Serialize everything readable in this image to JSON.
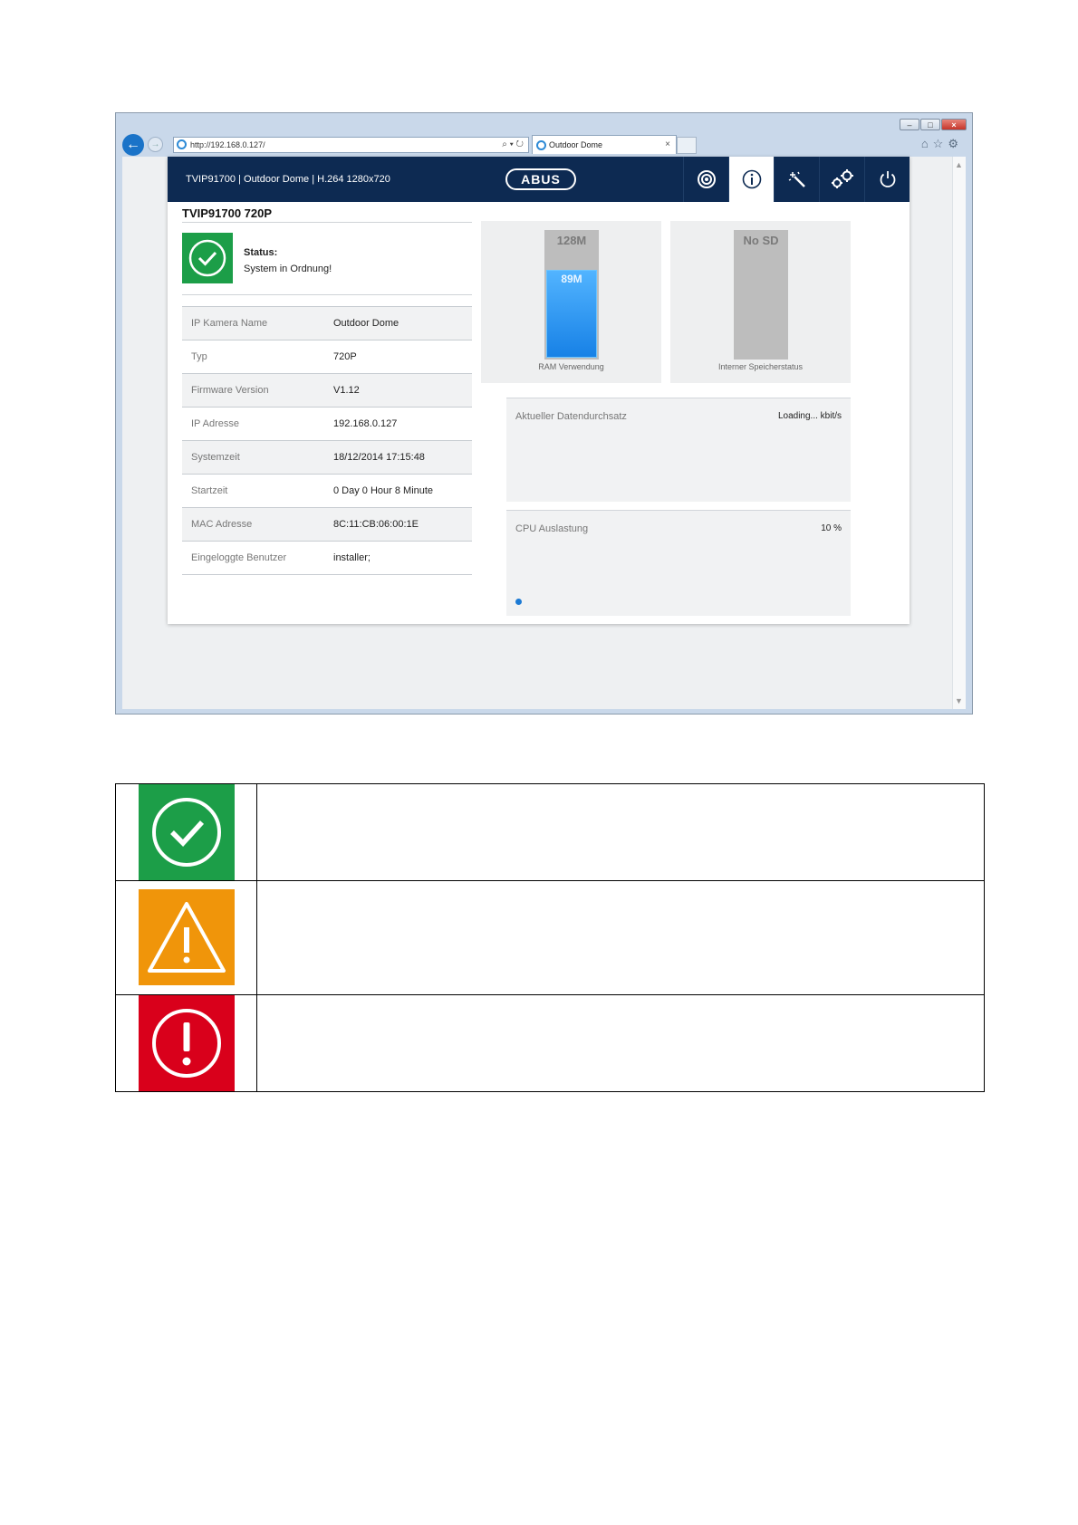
{
  "browser": {
    "url": "http://192.168.0.127/",
    "tab_title": "Outdoor Dome",
    "tab_close": "×",
    "min_label": "–",
    "max_label": "□",
    "close_label": "×",
    "back_glyph": "←",
    "fwd_glyph": "→",
    "addr_tools": "⌕ ▾ ↻",
    "right_icons": "⌂☆⚙",
    "scroll_up": "▲",
    "scroll_down": "▼"
  },
  "header": {
    "title": "TVIP91700 | Outdoor Dome | H.264 1280x720",
    "logo": "ABUS",
    "nav": [
      "live-view",
      "info",
      "wizard",
      "settings",
      "power"
    ]
  },
  "page": {
    "title": "TVIP91700 720P",
    "status_label": "Status:",
    "status_text": "System in Ordnung!"
  },
  "info_rows": [
    {
      "label": "IP Kamera Name",
      "value": "Outdoor Dome"
    },
    {
      "label": "Typ",
      "value": "720P"
    },
    {
      "label": "Firmware Version",
      "value": "V1.12"
    },
    {
      "label": "IP Adresse",
      "value": "192.168.0.127"
    },
    {
      "label": "Systemzeit",
      "value": "18/12/2014 17:15:48"
    },
    {
      "label": "Startzeit",
      "value": "0 Day 0 Hour 8 Minute"
    },
    {
      "label": "MAC Adresse",
      "value": "8C:11:CB:06:00:1E"
    },
    {
      "label": "Eingeloggte Benutzer",
      "value": "installer;"
    }
  ],
  "ram": {
    "total": "128M",
    "used": "89M",
    "fill_fraction": 0.6953,
    "caption": "RAM Verwendung"
  },
  "sd": {
    "status": "No SD",
    "caption": "Interner Speicherstatus"
  },
  "throughput": {
    "label": "Aktueller Datendurchsatz",
    "value": "Loading... kbit/s"
  },
  "cpu": {
    "label": "CPU Auslastung",
    "value": "10 %"
  },
  "colors": {
    "ok": "#1c9e48",
    "warning": "#f0950a",
    "error": "#d9001b",
    "header": "#0d2a52"
  },
  "legend_icons": [
    "check-circle-icon",
    "warning-triangle-icon",
    "error-circle-icon"
  ]
}
